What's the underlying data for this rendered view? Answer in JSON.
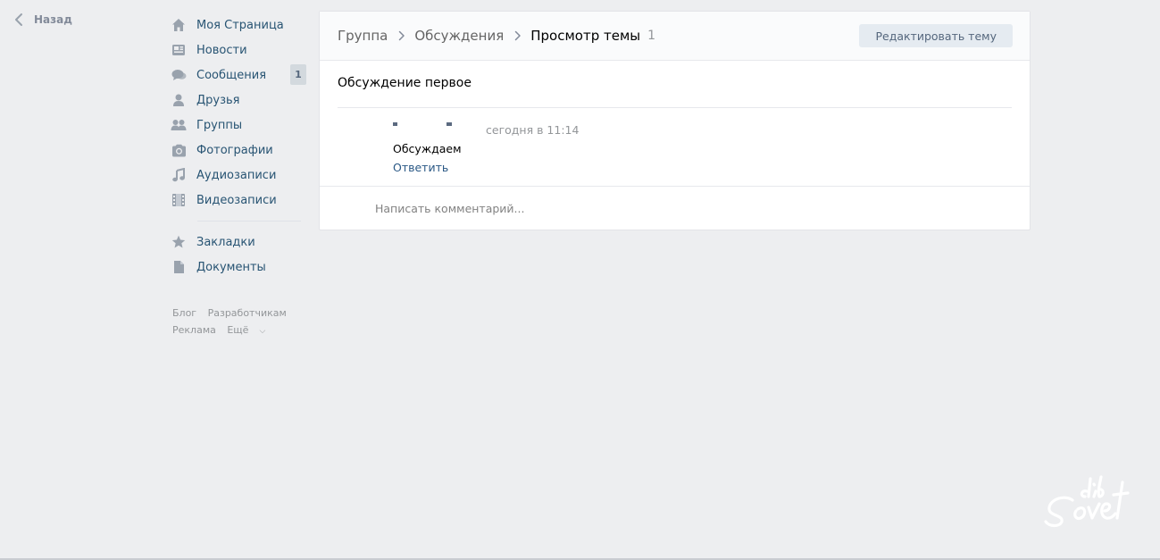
{
  "back": {
    "label": "Назад",
    "icon": "chevron-left-icon"
  },
  "sidebar": {
    "items": [
      {
        "label": "Моя Страница",
        "icon": "home-icon"
      },
      {
        "label": "Новости",
        "icon": "news-icon"
      },
      {
        "label": "Сообщения",
        "icon": "messages-icon",
        "badge": "1"
      },
      {
        "label": "Друзья",
        "icon": "friends-icon"
      },
      {
        "label": "Группы",
        "icon": "groups-icon"
      },
      {
        "label": "Фотографии",
        "icon": "camera-icon"
      },
      {
        "label": "Аудиозаписи",
        "icon": "music-icon"
      },
      {
        "label": "Видеозаписи",
        "icon": "video-icon"
      }
    ],
    "secondary_items": [
      {
        "label": "Закладки",
        "icon": "star-icon"
      },
      {
        "label": "Документы",
        "icon": "document-icon"
      }
    ],
    "footer": {
      "blog": "Блог",
      "developers": "Разработчикам",
      "ads": "Реклама",
      "more": "Ещё"
    }
  },
  "breadcrumb": {
    "group": "Группа",
    "discussions": "Обсуждения",
    "current": "Просмотр темы",
    "count": "1"
  },
  "edit_button": "Редактировать тему",
  "topic": {
    "title": "Обсуждение первое",
    "post": {
      "time": "сегодня в 11:14",
      "text": "Обсуждаем",
      "reply": "Ответить"
    }
  },
  "comment": {
    "placeholder": "Написать комментарий..."
  },
  "colors": {
    "background": "#edeef0",
    "link": "#2a5885",
    "nav_text": "#285473",
    "icon": "#99a2ad",
    "muted": "#939699"
  }
}
